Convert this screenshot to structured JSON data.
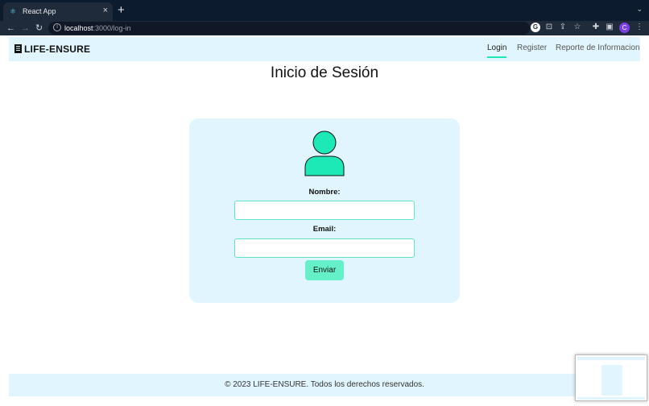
{
  "browser": {
    "tab_title": "React App",
    "url_host": "localhost",
    "url_path": ":3000/log-in",
    "avatar_initial": "C"
  },
  "app": {
    "brand": "LIFE-ENSURE",
    "nav": [
      {
        "label": "Login",
        "active": true
      },
      {
        "label": "Register",
        "active": false
      },
      {
        "label": "Reporte de Informacion",
        "active": false
      }
    ],
    "page_title": "Inicio de Sesión",
    "form": {
      "name_label": "Nombre:",
      "name_value": "",
      "email_label": "Email:",
      "email_value": "",
      "submit_label": "Enviar"
    },
    "footer": "© 2023 LIFE-ENSURE. Todos los derechos reservados."
  },
  "colors": {
    "accent": "#1de9b6",
    "icon_fill": "#1de9b6",
    "panel_bg": "#e1f5fe",
    "button_bg": "#64f0c9"
  }
}
